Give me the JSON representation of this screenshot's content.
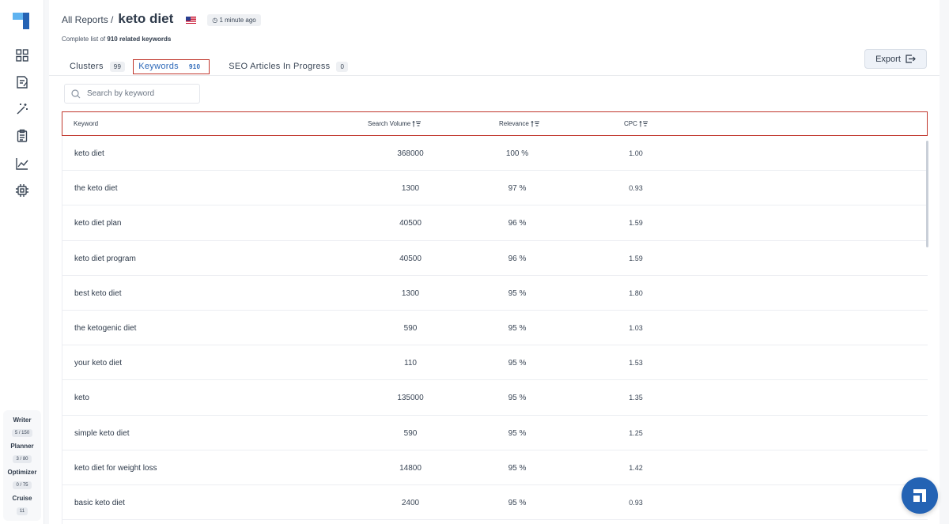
{
  "breadcrumb": {
    "parent": "All Reports /",
    "title": "keto diet"
  },
  "header": {
    "time_ago": "◷ 1 minute ago",
    "flag_icon": "us-flag-icon"
  },
  "subtitle": {
    "prefix": "Complete list of",
    "count_text": "910 related keywords"
  },
  "tabs": [
    {
      "label": "Clusters",
      "count": "99"
    },
    {
      "label": "Keywords",
      "count": "910",
      "active": true
    },
    {
      "label": "SEO Articles In Progress",
      "count": "0"
    }
  ],
  "export": {
    "label": "Export"
  },
  "search": {
    "placeholder": "Search by keyword",
    "value": ""
  },
  "table": {
    "columns": {
      "keyword": "Keyword",
      "volume": "Search Volume",
      "relevance": "Relevance",
      "cpc": "CPC"
    },
    "rows": [
      {
        "keyword": "keto diet",
        "volume": "368000",
        "relevance": "100 %",
        "cpc": "1.00"
      },
      {
        "keyword": "the keto diet",
        "volume": "1300",
        "relevance": "97 %",
        "cpc": "0.93"
      },
      {
        "keyword": "keto diet plan",
        "volume": "40500",
        "relevance": "96 %",
        "cpc": "1.59"
      },
      {
        "keyword": "keto diet program",
        "volume": "40500",
        "relevance": "96 %",
        "cpc": "1.59"
      },
      {
        "keyword": "best keto diet",
        "volume": "1300",
        "relevance": "95 %",
        "cpc": "1.80"
      },
      {
        "keyword": "the ketogenic diet",
        "volume": "590",
        "relevance": "95 %",
        "cpc": "1.03"
      },
      {
        "keyword": "your keto diet",
        "volume": "110",
        "relevance": "95 %",
        "cpc": "1.53"
      },
      {
        "keyword": "keto",
        "volume": "135000",
        "relevance": "95 %",
        "cpc": "1.35"
      },
      {
        "keyword": "simple keto diet",
        "volume": "590",
        "relevance": "95 %",
        "cpc": "1.25"
      },
      {
        "keyword": "keto diet for weight loss",
        "volume": "14800",
        "relevance": "95 %",
        "cpc": "1.42"
      },
      {
        "keyword": "basic keto diet",
        "volume": "2400",
        "relevance": "95 %",
        "cpc": "0.93"
      }
    ]
  },
  "usage": [
    {
      "label": "Writer",
      "value": "5 / 150"
    },
    {
      "label": "Planner",
      "value": "3 / 80"
    },
    {
      "label": "Optimizer",
      "value": "0 / 75"
    },
    {
      "label": "Cruise",
      "value": "11"
    }
  ],
  "colors": {
    "brand": "#2463b4",
    "accent": "#2b67b8",
    "highlight": "#c0362c"
  }
}
